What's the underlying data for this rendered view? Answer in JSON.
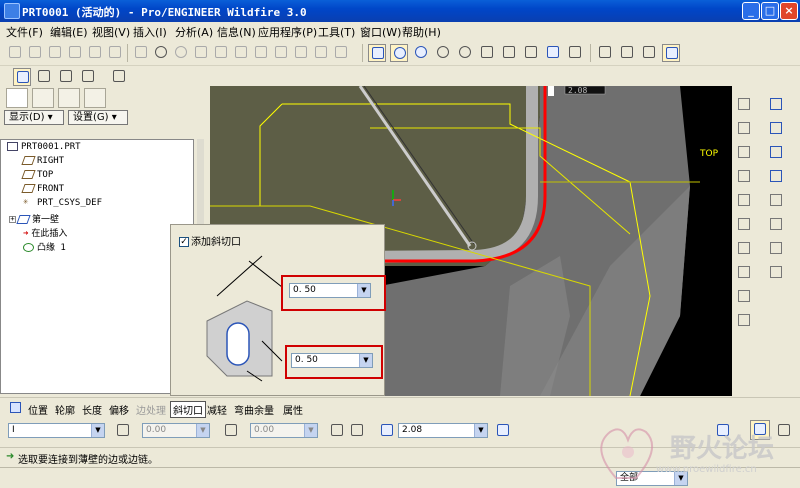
{
  "window": {
    "title": "PRT0001 (活动的) - Pro/ENGINEER Wildfire 3.0",
    "minimize": "_",
    "maximize": "□",
    "close": "×"
  },
  "menu": [
    "文件(F)",
    "编辑(E)",
    "视图(V)",
    "插入(I)",
    "分析(A)",
    "信息(N)",
    "应用程序(P)",
    "工具(T)",
    "窗口(W)",
    "帮助(H)"
  ],
  "model_tree": {
    "show_button": "显示(D) ▾",
    "settings_button": "设置(G) ▾",
    "items": [
      {
        "label": "PRT0001.PRT",
        "icon": "part-icon"
      },
      {
        "label": "RIGHT",
        "icon": "datum-plane-icon"
      },
      {
        "label": "TOP",
        "icon": "datum-plane-icon"
      },
      {
        "label": "FRONT",
        "icon": "datum-plane-icon"
      },
      {
        "label": "PRT_CSYS_DEF",
        "icon": "csys-icon"
      },
      {
        "label": "第一壁",
        "icon": "first-wall-icon"
      },
      {
        "label": "在此插入",
        "icon": "insert-here-arrow-icon"
      },
      {
        "label": "凸缘 1",
        "icon": "flange-icon"
      }
    ]
  },
  "viewport": {
    "dimension_label": "2.08",
    "datum_label": "TOP",
    "colors": {
      "background": "#000000",
      "wall_top": "#5d5e46",
      "wall_side": "#727272",
      "datum": "#ffff00",
      "edge": "#ff0000"
    }
  },
  "bevel": {
    "checkbox_label": "添加斜切口",
    "checked": true,
    "value1": "0. 50",
    "value2": "0. 50"
  },
  "dashboard": {
    "tabs": [
      "位置",
      "轮廓",
      "长度",
      "偏移",
      "边处理",
      "斜切口",
      "减轻",
      "弯曲余量",
      "属性"
    ],
    "active_tab": "斜切口",
    "disabled_tabs": [
      "边处理"
    ],
    "type_value": "I",
    "left_value": "0.00",
    "right_value": "0.00",
    "thickness_value": "2.08"
  },
  "status": {
    "message": "选取要连接到薄壁的边或边链。",
    "filter_value": "全部"
  },
  "watermark": {
    "text": "野火论坛",
    "url": "www.proewildfire.cn"
  }
}
